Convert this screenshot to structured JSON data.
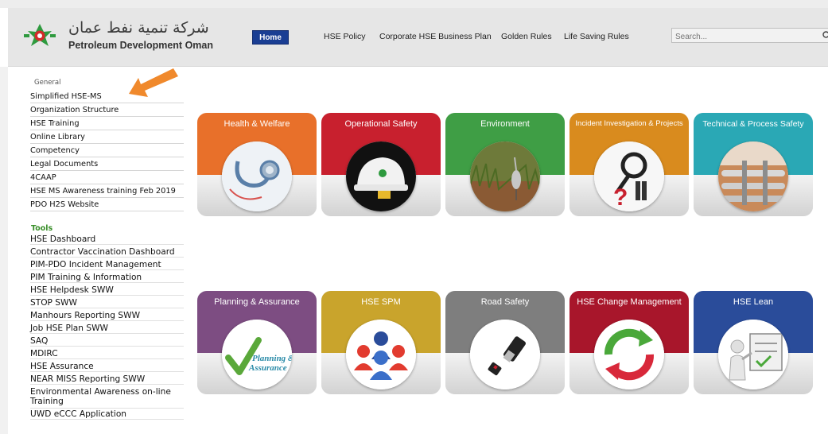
{
  "header": {
    "logo_arabic": "شركة تنمية نفط عمان",
    "logo_english": "Petroleum Development Oman",
    "nav": {
      "home": "Home",
      "hse_policy": "HSE Policy",
      "corporate_plan": "Corporate HSE Business Plan",
      "golden_rules": "Golden Rules",
      "life_saving_rules": "Life Saving Rules"
    },
    "search_placeholder": "Search..."
  },
  "sidebar": {
    "general_heading": "General",
    "general_items": [
      "Simplified HSE-MS",
      "Organization Structure",
      "HSE Training",
      "Online Library",
      "Competency",
      "Legal Documents",
      "4CAAP",
      "HSE MS Awareness training Feb 2019",
      "PDO H2S Website"
    ],
    "tools_heading": "Tools",
    "tools_items": [
      "HSE Dashboard",
      "Contractor Vaccination Dashboard",
      "PIM-PDO Incident Management",
      "PIM Training & Information",
      "HSE Helpdesk SWW",
      "STOP SWW",
      "Manhours Reporting SWW",
      "Job HSE Plan SWW",
      "SAQ",
      "MDIRC",
      "HSE Assurance",
      "NEAR MISS Reporting SWW",
      "Environmental Awareness on-line Training",
      "UWD eCCC Application"
    ]
  },
  "tiles": [
    {
      "title": "Health & Welfare",
      "color": "#e8702a",
      "icon": "stethoscope-icon"
    },
    {
      "title": "Operational Safety",
      "color": "#c8202e",
      "icon": "hard-hat-icon"
    },
    {
      "title": "Environment",
      "color": "#3f9e45",
      "icon": "heron-icon"
    },
    {
      "title": "Incident Investigation & Projects",
      "color": "#d98b1e",
      "icon": "investigation-icon"
    },
    {
      "title": "Technical & Process Safety",
      "color": "#2aa8b5",
      "icon": "pipeline-icon"
    },
    {
      "title": "Planning & Assurance",
      "color": "#7d4d82",
      "icon": "checkmark-icon",
      "circle_text": "Planning & Assurance"
    },
    {
      "title": "HSE SPM",
      "color": "#c9a42c",
      "icon": "people-icon"
    },
    {
      "title": "Road Safety",
      "color": "#7e7e7e",
      "icon": "seatbelt-icon"
    },
    {
      "title": "HSE Change Management",
      "color": "#a8162b",
      "icon": "cycle-arrows-icon"
    },
    {
      "title": "HSE Lean",
      "color": "#2a4c9a",
      "icon": "presenter-icon"
    }
  ]
}
